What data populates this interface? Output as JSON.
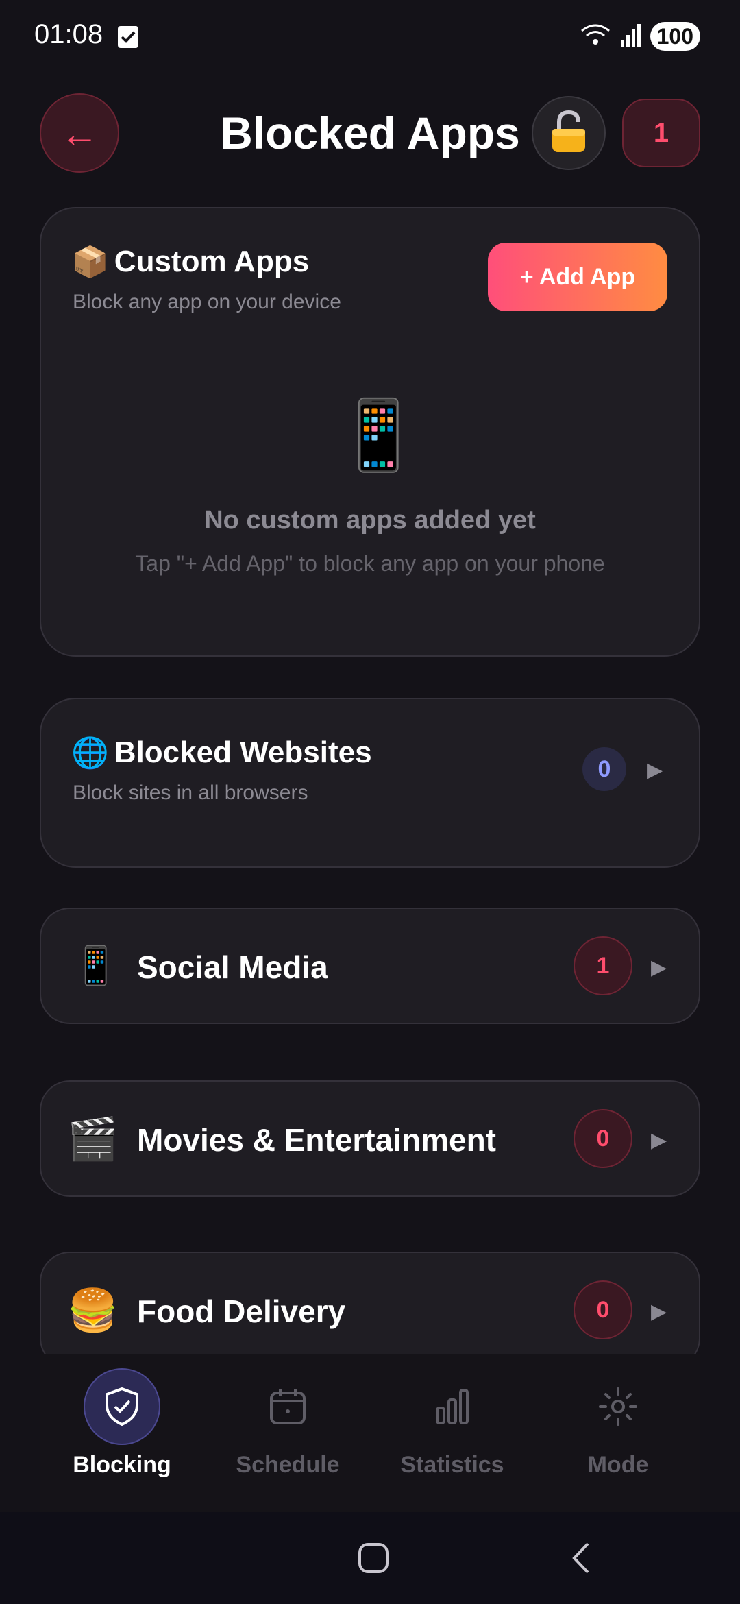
{
  "status_bar": {
    "time": "01:08",
    "battery": "100",
    "wifi_label": "5"
  },
  "header": {
    "title": "Blocked Apps",
    "back_icon": "←",
    "count": "1"
  },
  "custom_apps": {
    "emoji": "📦",
    "title": "Custom Apps",
    "subtitle": "Block any app on your device",
    "add_label": "+ Add App",
    "empty_emoji": "📱",
    "empty_title": "No custom apps added yet",
    "empty_subtitle": "Tap \"+ Add App\" to block any app on your phone"
  },
  "websites": {
    "emoji": "🌐",
    "title": "Blocked Websites",
    "subtitle": "Block sites in all browsers",
    "count": "0"
  },
  "categories": [
    {
      "emoji": "📱",
      "title": "Social Media",
      "count": "1"
    },
    {
      "emoji": "🎬",
      "title": "Movies & Entertainment",
      "count": "0"
    },
    {
      "emoji": "🍔",
      "title": "Food Delivery",
      "count": "0"
    }
  ],
  "chevron": "▶",
  "nav": [
    {
      "label": "Blocking",
      "icon": "shield-check-icon",
      "active": true
    },
    {
      "label": "Schedule",
      "icon": "calendar-icon",
      "active": false
    },
    {
      "label": "Statistics",
      "icon": "bar-chart-icon",
      "active": false
    },
    {
      "label": "Mode",
      "icon": "sun-icon",
      "active": false
    }
  ],
  "colors": {
    "accent_red": "#ff4d6d",
    "accent_blue": "#8f9bff",
    "background": "#141218",
    "card": "#1f1d23"
  }
}
